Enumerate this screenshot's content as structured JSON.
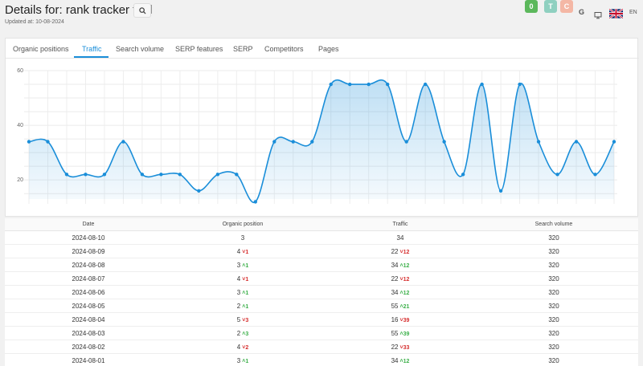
{
  "header": {
    "title": "Details for: rank tracker tool",
    "updated": "Updated at: 10-08-2024",
    "badges": [
      "0",
      "T",
      "C"
    ],
    "g_label": "G",
    "lang": "EN"
  },
  "tabs": [
    {
      "label": "Organic positions",
      "active": false
    },
    {
      "label": "Traffic",
      "active": true
    },
    {
      "label": "Search volume",
      "active": false
    },
    {
      "label": "SERP features",
      "active": false
    },
    {
      "label": "SERP",
      "active": false
    },
    {
      "label": "Competitors",
      "active": false
    },
    {
      "label": "Pages",
      "active": false
    }
  ],
  "chart_data": {
    "type": "area",
    "ylim": [
      13,
      60
    ],
    "yticks": [
      20,
      40,
      60
    ],
    "grid": true,
    "color": "#1a8ed9",
    "values": [
      34,
      34,
      22,
      22,
      22,
      34,
      22,
      22,
      22,
      16,
      22,
      22,
      12,
      34,
      34,
      34,
      55,
      55,
      55,
      55,
      34,
      55,
      34,
      22,
      55,
      16,
      55,
      34,
      22,
      34,
      22,
      34
    ]
  },
  "table": {
    "headers": [
      "Date",
      "Organic position",
      "Traffic",
      "Search volume"
    ],
    "rows": [
      {
        "date": "2024-08-10",
        "pos": "3",
        "pos_chg": "",
        "pos_dir": "",
        "traffic": "34",
        "tr_chg": "",
        "tr_dir": "",
        "volume": "320"
      },
      {
        "date": "2024-08-09",
        "pos": "4",
        "pos_chg": "1",
        "pos_dir": "down",
        "traffic": "22",
        "tr_chg": "12",
        "tr_dir": "down",
        "volume": "320"
      },
      {
        "date": "2024-08-08",
        "pos": "3",
        "pos_chg": "1",
        "pos_dir": "up",
        "traffic": "34",
        "tr_chg": "12",
        "tr_dir": "up",
        "volume": "320"
      },
      {
        "date": "2024-08-07",
        "pos": "4",
        "pos_chg": "1",
        "pos_dir": "down",
        "traffic": "22",
        "tr_chg": "12",
        "tr_dir": "down",
        "volume": "320"
      },
      {
        "date": "2024-08-06",
        "pos": "3",
        "pos_chg": "1",
        "pos_dir": "up",
        "traffic": "34",
        "tr_chg": "12",
        "tr_dir": "up",
        "volume": "320"
      },
      {
        "date": "2024-08-05",
        "pos": "2",
        "pos_chg": "1",
        "pos_dir": "up",
        "traffic": "55",
        "tr_chg": "21",
        "tr_dir": "up",
        "volume": "320"
      },
      {
        "date": "2024-08-04",
        "pos": "5",
        "pos_chg": "3",
        "pos_dir": "down",
        "traffic": "16",
        "tr_chg": "39",
        "tr_dir": "down",
        "volume": "320"
      },
      {
        "date": "2024-08-03",
        "pos": "2",
        "pos_chg": "3",
        "pos_dir": "up",
        "traffic": "55",
        "tr_chg": "39",
        "tr_dir": "up",
        "volume": "320"
      },
      {
        "date": "2024-08-02",
        "pos": "4",
        "pos_chg": "2",
        "pos_dir": "down",
        "traffic": "22",
        "tr_chg": "33",
        "tr_dir": "down",
        "volume": "320"
      },
      {
        "date": "2024-08-01",
        "pos": "3",
        "pos_chg": "1",
        "pos_dir": "up",
        "traffic": "34",
        "tr_chg": "12",
        "tr_dir": "up",
        "volume": "320"
      }
    ]
  }
}
